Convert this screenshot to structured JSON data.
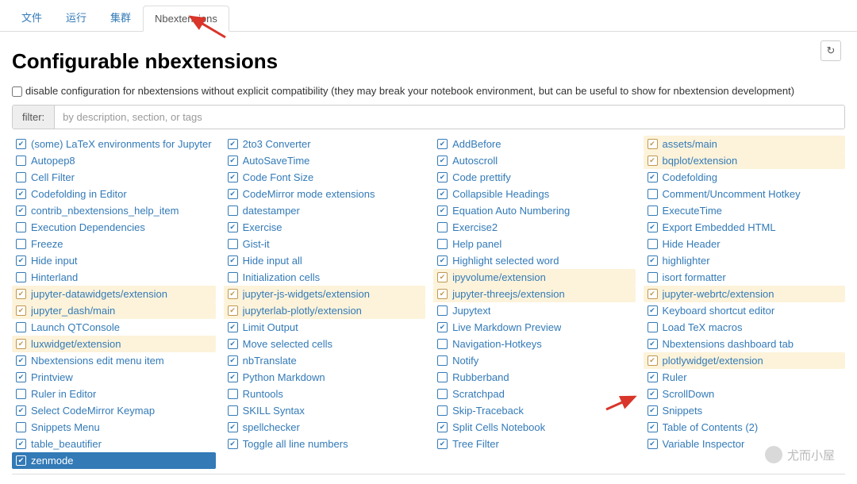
{
  "tabs": {
    "items": [
      "文件",
      "运行",
      "集群",
      "Nbextensions"
    ],
    "active_index": 3
  },
  "refresh_icon": "↻",
  "title": "Configurable nbextensions",
  "disable_label": "disable configuration for nbextensions without explicit compatibility (they may break your notebook environment, but can be useful to show for nbextension development)",
  "filter": {
    "label": "filter:",
    "placeholder": "by description, section, or tags"
  },
  "extensions": [
    {
      "label": "(some) LaTeX environments for Jupyter",
      "checked": true,
      "hl": false
    },
    {
      "label": "2to3 Converter",
      "checked": true,
      "hl": false
    },
    {
      "label": "AddBefore",
      "checked": true,
      "hl": false
    },
    {
      "label": "assets/main",
      "checked": true,
      "hl": true
    },
    {
      "label": "Autopep8",
      "checked": false,
      "hl": false
    },
    {
      "label": "AutoSaveTime",
      "checked": true,
      "hl": false
    },
    {
      "label": "Autoscroll",
      "checked": true,
      "hl": false
    },
    {
      "label": "bqplot/extension",
      "checked": true,
      "hl": true
    },
    {
      "label": "Cell Filter",
      "checked": false,
      "hl": false
    },
    {
      "label": "Code Font Size",
      "checked": true,
      "hl": false
    },
    {
      "label": "Code prettify",
      "checked": true,
      "hl": false
    },
    {
      "label": "Codefolding",
      "checked": true,
      "hl": false
    },
    {
      "label": "Codefolding in Editor",
      "checked": true,
      "hl": false
    },
    {
      "label": "CodeMirror mode extensions",
      "checked": true,
      "hl": false
    },
    {
      "label": "Collapsible Headings",
      "checked": true,
      "hl": false
    },
    {
      "label": "Comment/Uncomment Hotkey",
      "checked": false,
      "hl": false
    },
    {
      "label": "contrib_nbextensions_help_item",
      "checked": true,
      "hl": false
    },
    {
      "label": "datestamper",
      "checked": false,
      "hl": false
    },
    {
      "label": "Equation Auto Numbering",
      "checked": true,
      "hl": false
    },
    {
      "label": "ExecuteTime",
      "checked": false,
      "hl": false
    },
    {
      "label": "Execution Dependencies",
      "checked": false,
      "hl": false
    },
    {
      "label": "Exercise",
      "checked": true,
      "hl": false
    },
    {
      "label": "Exercise2",
      "checked": false,
      "hl": false
    },
    {
      "label": "Export Embedded HTML",
      "checked": true,
      "hl": false
    },
    {
      "label": "Freeze",
      "checked": false,
      "hl": false
    },
    {
      "label": "Gist-it",
      "checked": false,
      "hl": false
    },
    {
      "label": "Help panel",
      "checked": false,
      "hl": false
    },
    {
      "label": "Hide Header",
      "checked": false,
      "hl": false
    },
    {
      "label": "Hide input",
      "checked": true,
      "hl": false
    },
    {
      "label": "Hide input all",
      "checked": true,
      "hl": false
    },
    {
      "label": "Highlight selected word",
      "checked": true,
      "hl": false
    },
    {
      "label": "highlighter",
      "checked": true,
      "hl": false
    },
    {
      "label": "Hinterland",
      "checked": false,
      "hl": false
    },
    {
      "label": "Initialization cells",
      "checked": false,
      "hl": false
    },
    {
      "label": "ipyvolume/extension",
      "checked": true,
      "hl": true
    },
    {
      "label": "isort formatter",
      "checked": false,
      "hl": false
    },
    {
      "label": "jupyter-datawidgets/extension",
      "checked": true,
      "hl": true
    },
    {
      "label": "jupyter-js-widgets/extension",
      "checked": true,
      "hl": true
    },
    {
      "label": "jupyter-threejs/extension",
      "checked": true,
      "hl": true
    },
    {
      "label": "jupyter-webrtc/extension",
      "checked": true,
      "hl": true
    },
    {
      "label": "jupyter_dash/main",
      "checked": true,
      "hl": true
    },
    {
      "label": "jupyterlab-plotly/extension",
      "checked": true,
      "hl": true
    },
    {
      "label": "Jupytext",
      "checked": false,
      "hl": false
    },
    {
      "label": "Keyboard shortcut editor",
      "checked": true,
      "hl": false
    },
    {
      "label": "Launch QTConsole",
      "checked": false,
      "hl": false
    },
    {
      "label": "Limit Output",
      "checked": true,
      "hl": false
    },
    {
      "label": "Live Markdown Preview",
      "checked": true,
      "hl": false
    },
    {
      "label": "Load TeX macros",
      "checked": false,
      "hl": false
    },
    {
      "label": "luxwidget/extension",
      "checked": true,
      "hl": true
    },
    {
      "label": "Move selected cells",
      "checked": true,
      "hl": false
    },
    {
      "label": "Navigation-Hotkeys",
      "checked": false,
      "hl": false
    },
    {
      "label": "Nbextensions dashboard tab",
      "checked": true,
      "hl": false
    },
    {
      "label": "Nbextensions edit menu item",
      "checked": true,
      "hl": false
    },
    {
      "label": "nbTranslate",
      "checked": true,
      "hl": false
    },
    {
      "label": "Notify",
      "checked": false,
      "hl": false
    },
    {
      "label": "plotlywidget/extension",
      "checked": true,
      "hl": true
    },
    {
      "label": "Printview",
      "checked": true,
      "hl": false
    },
    {
      "label": "Python Markdown",
      "checked": true,
      "hl": false
    },
    {
      "label": "Rubberband",
      "checked": false,
      "hl": false
    },
    {
      "label": "Ruler",
      "checked": true,
      "hl": false
    },
    {
      "label": "Ruler in Editor",
      "checked": false,
      "hl": false
    },
    {
      "label": "Runtools",
      "checked": false,
      "hl": false
    },
    {
      "label": "Scratchpad",
      "checked": false,
      "hl": false
    },
    {
      "label": "ScrollDown",
      "checked": true,
      "hl": false
    },
    {
      "label": "Select CodeMirror Keymap",
      "checked": true,
      "hl": false
    },
    {
      "label": "SKILL Syntax",
      "checked": false,
      "hl": false
    },
    {
      "label": "Skip-Traceback",
      "checked": false,
      "hl": false
    },
    {
      "label": "Snippets",
      "checked": true,
      "hl": false
    },
    {
      "label": "Snippets Menu",
      "checked": false,
      "hl": false
    },
    {
      "label": "spellchecker",
      "checked": true,
      "hl": false
    },
    {
      "label": "Split Cells Notebook",
      "checked": true,
      "hl": false
    },
    {
      "label": "Table of Contents (2)",
      "checked": true,
      "hl": false
    },
    {
      "label": "table_beautifier",
      "checked": true,
      "hl": false
    },
    {
      "label": "Toggle all line numbers",
      "checked": true,
      "hl": false
    },
    {
      "label": "Tree Filter",
      "checked": true,
      "hl": false
    },
    {
      "label": "Variable Inspector",
      "checked": true,
      "hl": false
    },
    {
      "label": "zenmode",
      "checked": true,
      "hl": false,
      "sel": true
    }
  ],
  "watermark": "尤而小屋"
}
